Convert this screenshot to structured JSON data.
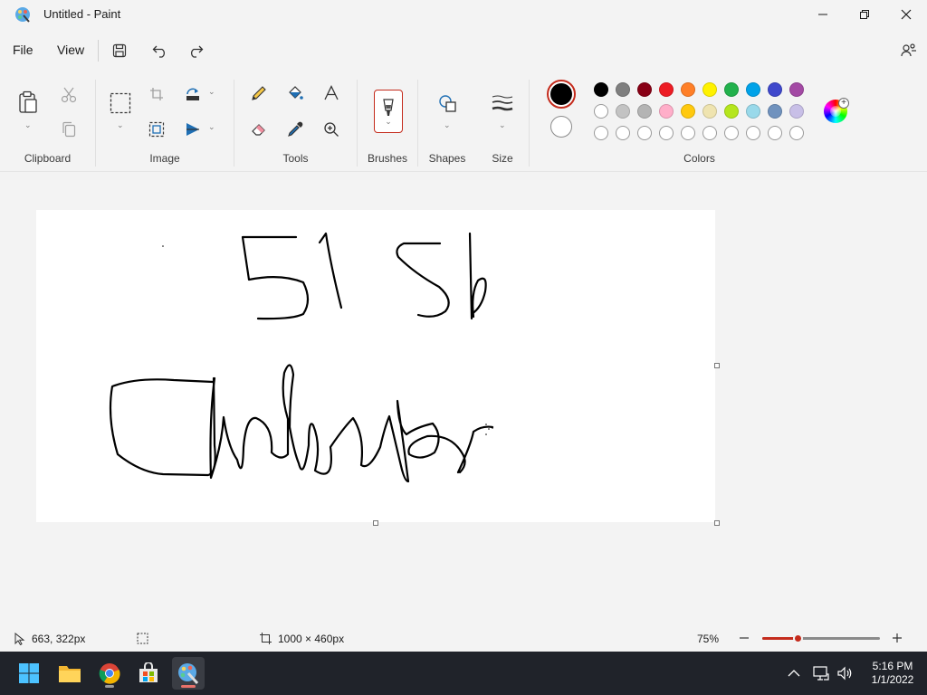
{
  "window": {
    "title": "Untitled - Paint"
  },
  "menu": {
    "file": "File",
    "view": "View"
  },
  "ribbon": {
    "groups": {
      "clipboard": "Clipboard",
      "image": "Image",
      "tools": "Tools",
      "brushes": "Brushes",
      "shapes": "Shapes",
      "size": "Size",
      "colors": "Colors"
    }
  },
  "colors": {
    "primary": "#000000",
    "secondary": "#ffffff",
    "palette_row1": [
      "#000000",
      "#7f7f7f",
      "#880015",
      "#ed1c24",
      "#ff7f27",
      "#fff200",
      "#22b14c",
      "#00a2e8",
      "#3f48cc",
      "#a349a4"
    ],
    "palette_row2": [
      "#ffffff",
      "#c3c3c3",
      "#b4b4b4",
      "#ffaec9",
      "#ffc90e",
      "#efe4b0",
      "#b5e61d",
      "#99d9ea",
      "#7092be",
      "#c8bfe7"
    ],
    "palette_row3_empty": 10,
    "accent": "#c42b1c"
  },
  "status": {
    "cursor_position": "663, 322px",
    "canvas_size": "1000 × 460px",
    "zoom": "75%",
    "zoom_fraction": 0.3
  },
  "taskbar": {
    "apps": [
      "start",
      "file-explorer",
      "chrome",
      "microsoft-store",
      "paint"
    ],
    "time": "5:16 PM",
    "date": "1/1/2022"
  }
}
